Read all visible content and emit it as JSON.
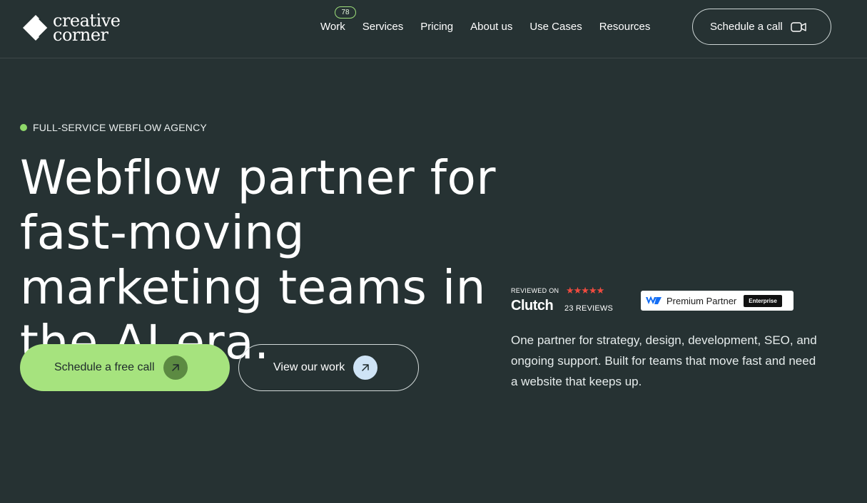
{
  "header": {
    "logo": {
      "line1": "creative",
      "line2": "corner"
    },
    "nav": [
      {
        "label": "Work",
        "badge": "78"
      },
      {
        "label": "Services"
      },
      {
        "label": "Pricing"
      },
      {
        "label": "About us"
      },
      {
        "label": "Use Cases"
      },
      {
        "label": "Resources"
      }
    ],
    "cta_label": "Schedule a call",
    "cta_icon": "video-camera-icon"
  },
  "hero": {
    "eyebrow": "FULL-SERVICE WEBFLOW AGENCY",
    "headline": "Webflow partner for fast-moving marketing teams in the AI era.",
    "primary_button": {
      "label": "Schedule a free call",
      "icon": "arrow-up-right-icon"
    },
    "secondary_button": {
      "label": "View our work",
      "icon": "arrow-up-right-icon"
    }
  },
  "badges": {
    "clutch": {
      "reviewed_on": "REVIEWED ON",
      "brand": "Clutch",
      "rating_stars": 5,
      "stars_text": "★★★★★",
      "reviews": "23 REVIEWS"
    },
    "webflow": {
      "label": "Premium Partner",
      "tier": "Enterprise"
    }
  },
  "description": "One partner for strategy, design, development, SEO, and ongoing support. Built for teams that move fast and need a website that keeps up.",
  "colors": {
    "background": "#263233",
    "accent_green": "#a6e37e",
    "clutch_star_red": "#ef4b3f",
    "webflow_blue": "#146ef5"
  }
}
